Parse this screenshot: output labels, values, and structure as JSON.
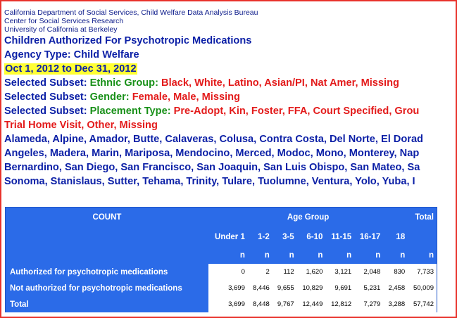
{
  "header": {
    "org_lines": [
      "California Department of Social Services, Child Welfare Data Analysis Bureau",
      "Center for Social Services Research",
      "University of California at Berkeley"
    ],
    "report_title": "Children Authorized For Psychotropic Medications",
    "agency_type": "Agency Type: Child Welfare",
    "date_range": "Oct 1, 2012 to Dec 31, 2012",
    "subsets": [
      {
        "label": "Selected Subset:",
        "field": "Ethnic Group:",
        "values": "Black, White, Latino, Asian/PI, Nat Amer, Missing"
      },
      {
        "label": "Selected Subset:",
        "field": "Gender:",
        "values": "Female, Male, Missing"
      },
      {
        "label": "Selected Subset:",
        "field": "Placement Type:",
        "values": "Pre-Adopt, Kin, Foster, FFA, Court Specified, Grou"
      }
    ],
    "placement_cont": "Trial Home Visit, Other, Missing",
    "counties": [
      "Alameda, Alpine, Amador, Butte, Calaveras, Colusa, Contra Costa, Del Norte, El Dorad",
      "Angeles, Madera, Marin, Mariposa, Mendocino, Merced, Modoc, Mono, Monterey, Nap",
      "Bernardino, San Diego, San Francisco, San Joaquin, San Luis Obispo, San Mateo, Sa",
      "Sonoma, Stanislaus, Sutter, Tehama, Trinity, Tulare, Tuolumne, Ventura, Yolo, Yuba, I"
    ]
  },
  "table": {
    "count_label": "COUNT",
    "group_label": "Age Group",
    "total_label": "Total",
    "columns": [
      "Under 1",
      "1-2",
      "3-5",
      "6-10",
      "11-15",
      "16-17",
      "18"
    ],
    "unit": "n",
    "rows": [
      {
        "label": "Authorized for psychotropic medications",
        "values": [
          "0",
          "2",
          "112",
          "1,620",
          "3,121",
          "2,048",
          "830",
          "7,733"
        ]
      },
      {
        "label": "Not authorized for psychotropic medications",
        "values": [
          "3,699",
          "8,446",
          "9,655",
          "10,829",
          "9,691",
          "5,231",
          "2,458",
          "50,009"
        ]
      },
      {
        "label": "Total",
        "values": [
          "3,699",
          "8,448",
          "9,767",
          "12,449",
          "12,812",
          "7,279",
          "3,288",
          "57,742"
        ]
      }
    ]
  }
}
